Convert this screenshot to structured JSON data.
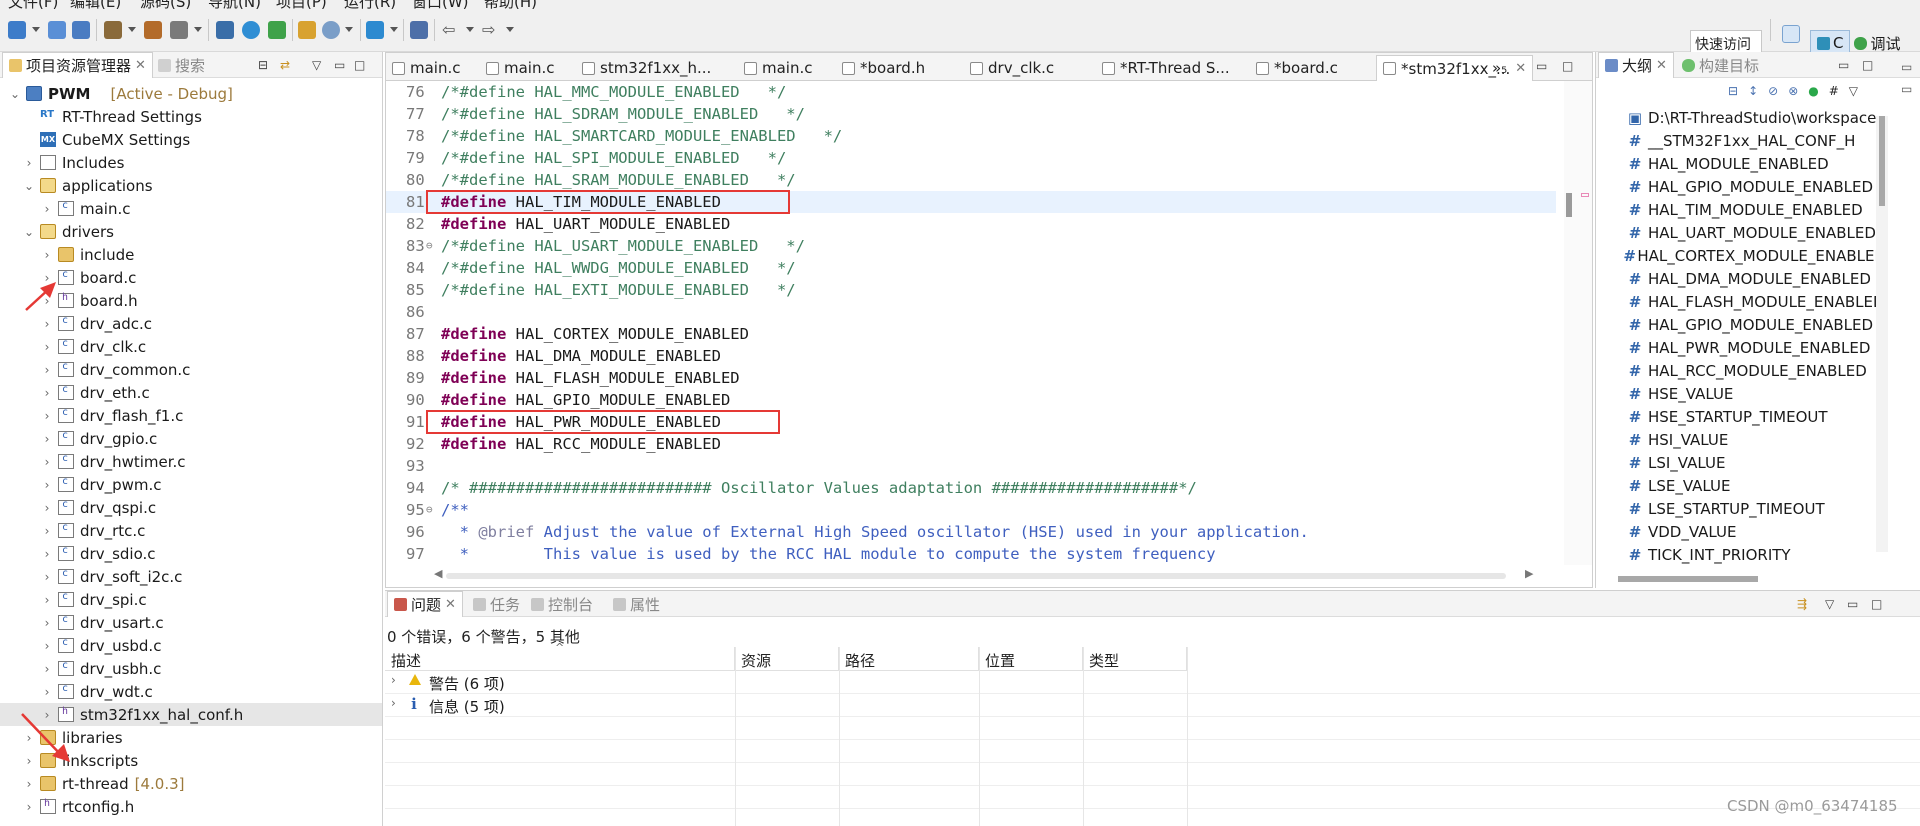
{
  "menubar": {
    "items": [
      "文件(F)",
      "编辑(E)",
      "源码(S)",
      "导航(N)",
      "项目(P)",
      "运行(R)",
      "窗口(W)",
      "帮助(H)"
    ]
  },
  "toolbar": {
    "quick_access_label": "快速访问",
    "perspective_c_label": "C",
    "perspective_debug_label": "调试"
  },
  "explorer": {
    "tab_label": "项目资源管理器",
    "search_tab_label": "搜索",
    "project_name": "PWM",
    "project_state": "[Active - Debug]",
    "rt_settings": "RT-Thread Settings",
    "cubemx_settings": "CubeMX Settings",
    "includes": "Includes",
    "applications": "applications",
    "main_c": "main.c",
    "drivers": "drivers",
    "driver_files": [
      "include",
      "board.c",
      "board.h",
      "drv_adc.c",
      "drv_clk.c",
      "drv_common.c",
      "drv_eth.c",
      "drv_flash_f1.c",
      "drv_gpio.c",
      "drv_hwtimer.c",
      "drv_pwm.c",
      "drv_qspi.c",
      "drv_rtc.c",
      "drv_sdio.c",
      "drv_soft_i2c.c",
      "drv_spi.c",
      "drv_usart.c",
      "drv_usbd.c",
      "drv_usbh.c",
      "drv_wdt.c",
      "stm32f1xx_hal_conf.h"
    ],
    "libraries": "libraries",
    "linkscripts": "linkscripts",
    "rt_thread": "rt-thread",
    "rt_thread_version": "[4.0.3]",
    "rtconfig_h": "rtconfig.h"
  },
  "editor": {
    "tabs": [
      "main.c",
      "main.c",
      "stm32f1xx_h...",
      "main.c",
      "*board.h",
      "drv_clk.c",
      "*RT-Thread S...",
      "*board.c",
      "*stm32f1xx_..."
    ],
    "overflow_label": "»₅",
    "lines": [
      {
        "n": "76",
        "text": "/*#define HAL_MMC_MODULE_ENABLED   */"
      },
      {
        "n": "77",
        "text": "/*#define HAL_SDRAM_MODULE_ENABLED   */"
      },
      {
        "n": "78",
        "text": "/*#define HAL_SMARTCARD_MODULE_ENABLED   */"
      },
      {
        "n": "79",
        "text": "/*#define HAL_SPI_MODULE_ENABLED   */"
      },
      {
        "n": "80",
        "text": "/*#define HAL_SRAM_MODULE_ENABLED   */"
      },
      {
        "n": "81",
        "kw": "#define",
        "text": " HAL_TIM_MODULE_ENABLED"
      },
      {
        "n": "82",
        "kw": "#define",
        "text": " HAL_UART_MODULE_ENABLED"
      },
      {
        "n": "83",
        "text": "/*#define HAL_USART_MODULE_ENABLED   */"
      },
      {
        "n": "84",
        "text": "/*#define HAL_WWDG_MODULE_ENABLED   */"
      },
      {
        "n": "85",
        "text": "/*#define HAL_EXTI_MODULE_ENABLED   */"
      },
      {
        "n": "86",
        "text": ""
      },
      {
        "n": "87",
        "kw": "#define",
        "text": " HAL_CORTEX_MODULE_ENABLED"
      },
      {
        "n": "88",
        "kw": "#define",
        "text": " HAL_DMA_MODULE_ENABLED"
      },
      {
        "n": "89",
        "kw": "#define",
        "text": " HAL_FLASH_MODULE_ENABLED"
      },
      {
        "n": "90",
        "kw": "#define",
        "text": " HAL_GPIO_MODULE_ENABLED"
      },
      {
        "n": "91",
        "kw": "#define",
        "text": " HAL_PWR_MODULE_ENABLED"
      },
      {
        "n": "92",
        "kw": "#define",
        "text": " HAL_RCC_MODULE_ENABLED"
      },
      {
        "n": "93",
        "text": ""
      },
      {
        "n": "94",
        "text": "/* ########################## Oscillator Values adaptation ####################*/"
      },
      {
        "n": "95",
        "text": "/**"
      },
      {
        "n": "96",
        "tag": "@brief",
        "text": " Adjust the value of External High Speed oscillator (HSE) used in your application."
      },
      {
        "n": "97",
        "text": "  *        This value is used by the RCC HAL module to compute the system frequency"
      }
    ]
  },
  "outline": {
    "tab_label": "大纲",
    "build_targets_label": "构建目标",
    "items": [
      "D:\\RT-ThreadStudio\\workspace",
      "__STM32F1xx_HAL_CONF_H",
      "HAL_MODULE_ENABLED",
      "HAL_GPIO_MODULE_ENABLED",
      "HAL_TIM_MODULE_ENABLED",
      "HAL_UART_MODULE_ENABLED",
      "HAL_CORTEX_MODULE_ENABLED",
      "HAL_DMA_MODULE_ENABLED",
      "HAL_FLASH_MODULE_ENABLED",
      "HAL_GPIO_MODULE_ENABLED",
      "HAL_PWR_MODULE_ENABLED",
      "HAL_RCC_MODULE_ENABLED",
      "HSE_VALUE",
      "HSE_STARTUP_TIMEOUT",
      "HSI_VALUE",
      "LSI_VALUE",
      "LSE_VALUE",
      "LSE_STARTUP_TIMEOUT",
      "VDD_VALUE",
      "TICK_INT_PRIORITY"
    ]
  },
  "problems": {
    "tabs": [
      "问题",
      "任务",
      "控制台",
      "属性"
    ],
    "summary": "0 个错误，6 个警告，5 其他",
    "columns": [
      "描述",
      "资源",
      "路径",
      "位置",
      "类型"
    ],
    "rows": [
      {
        "label": "警告 (6 项)"
      },
      {
        "label": "信息 (5 项)"
      }
    ]
  },
  "watermark": "CSDN @m0_63474185",
  "colors": {
    "annotation_red": "#e53935",
    "keyword": "#7f0055",
    "comment": "#3f7f5f",
    "javadoc": "#3f5fbf"
  }
}
